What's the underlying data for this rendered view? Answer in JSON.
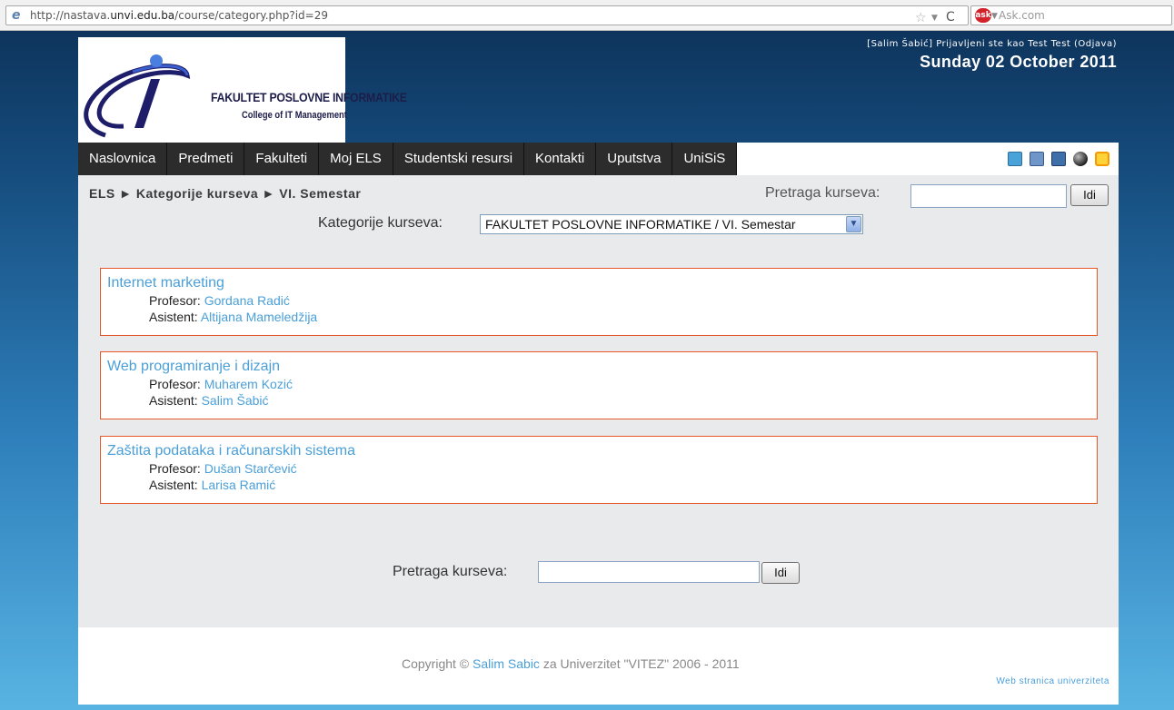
{
  "browser": {
    "url_prefix": "http://nastava.",
    "url_host": "unvi.edu.ba",
    "url_suffix": "/course/category.php?id=29",
    "search_engine": "Ask.com"
  },
  "header": {
    "logo_title": "FAKULTET POSLOVNE INFORMATIKE",
    "logo_subtitle": "College of IT Management",
    "login_info": "[Salim Šabić] Prijavljeni ste kao Test Test (Odjava)",
    "date": "Sunday 02 October 2011"
  },
  "nav": {
    "items": [
      {
        "label": "Naslovnica"
      },
      {
        "label": "Predmeti"
      },
      {
        "label": "Fakulteti"
      },
      {
        "label": "Moj ELS"
      },
      {
        "label": "Studentski resursi"
      },
      {
        "label": "Kontakti"
      },
      {
        "label": "Uputstva"
      },
      {
        "label": "UniSiS"
      }
    ]
  },
  "main": {
    "breadcrumb": "ELS ► Kategorije kurseva ► VI. Semestar",
    "search_label": "Pretraga kurseva:",
    "search_button": "Idi",
    "category_label": "Kategorije kurseva:",
    "category_selected": "FAKULTET POSLOVNE INFORMATIKE / VI. Semestar",
    "professor_label": "Profesor:",
    "assistant_label": "Asistent:",
    "courses": [
      {
        "name": "Internet marketing",
        "professor": "Gordana Radić",
        "assistant": "Altijana Mameledžija"
      },
      {
        "name": "Web programiranje i dizajn",
        "professor": "Muharem Kozić",
        "assistant": "Salim Šabić"
      },
      {
        "name": "Zaštita podataka i računarskih sistema",
        "professor": "Dušan Starčević",
        "assistant": "Larisa Ramić"
      }
    ],
    "bottom_search_label": "Pretraga kurseva:",
    "bottom_search_button": "Idi"
  },
  "footer": {
    "copyright_prefix": "Copyright © ",
    "copyright_link": "Salim Sabic",
    "copyright_suffix": " za Univerzitet \"VITEZ\" 2006 - 2011",
    "web_link": "Web stranica univerziteta"
  }
}
